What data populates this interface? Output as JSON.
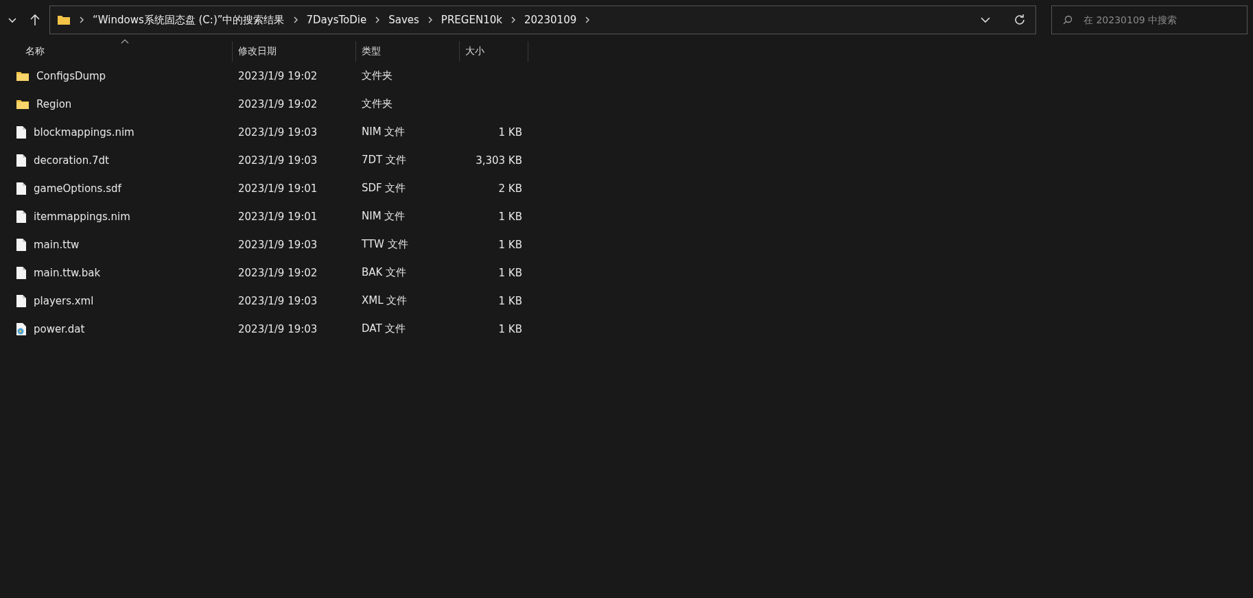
{
  "address_bar": {
    "crumbs": [
      "“Windows系统固态盘 (C:)”中的搜索结果",
      "7DaysToDie",
      "Saves",
      "PREGEN10k",
      "20230109"
    ]
  },
  "search": {
    "placeholder": "在 20230109 中搜索"
  },
  "columns": [
    {
      "label": "名称",
      "sorted": true
    },
    {
      "label": "修改日期",
      "sorted": false
    },
    {
      "label": "类型",
      "sorted": false
    },
    {
      "label": "大小",
      "sorted": false
    }
  ],
  "files": [
    {
      "kind": "folder",
      "name": "ConfigsDump",
      "date": "2023/1/9 19:02",
      "type": "文件夹"
    },
    {
      "kind": "folder",
      "name": "Region",
      "date": "2023/1/9 19:02",
      "type": "文件夹"
    },
    {
      "kind": "file",
      "name": "blockmappings.nim",
      "date": "2023/1/9 19:03",
      "type": "NIM 文件",
      "size": "1 KB"
    },
    {
      "kind": "file",
      "name": "decoration.7dt",
      "date": "2023/1/9 19:03",
      "type": "7DT 文件",
      "size": "3,303 KB"
    },
    {
      "kind": "file",
      "name": "gameOptions.sdf",
      "date": "2023/1/9 19:01",
      "type": "SDF 文件",
      "size": "2 KB"
    },
    {
      "kind": "file",
      "name": "itemmappings.nim",
      "date": "2023/1/9 19:01",
      "type": "NIM 文件",
      "size": "1 KB"
    },
    {
      "kind": "file",
      "name": "main.ttw",
      "date": "2023/1/9 19:03",
      "type": "TTW 文件",
      "size": "1 KB"
    },
    {
      "kind": "file",
      "name": "main.ttw.bak",
      "date": "2023/1/9 19:02",
      "type": "BAK 文件",
      "size": "1 KB"
    },
    {
      "kind": "file",
      "name": "players.xml",
      "date": "2023/1/9 19:03",
      "type": "XML 文件",
      "size": "1 KB"
    },
    {
      "kind": "media",
      "name": "power.dat",
      "date": "2023/1/9 19:03",
      "type": "DAT 文件",
      "size": "1 KB"
    }
  ]
}
